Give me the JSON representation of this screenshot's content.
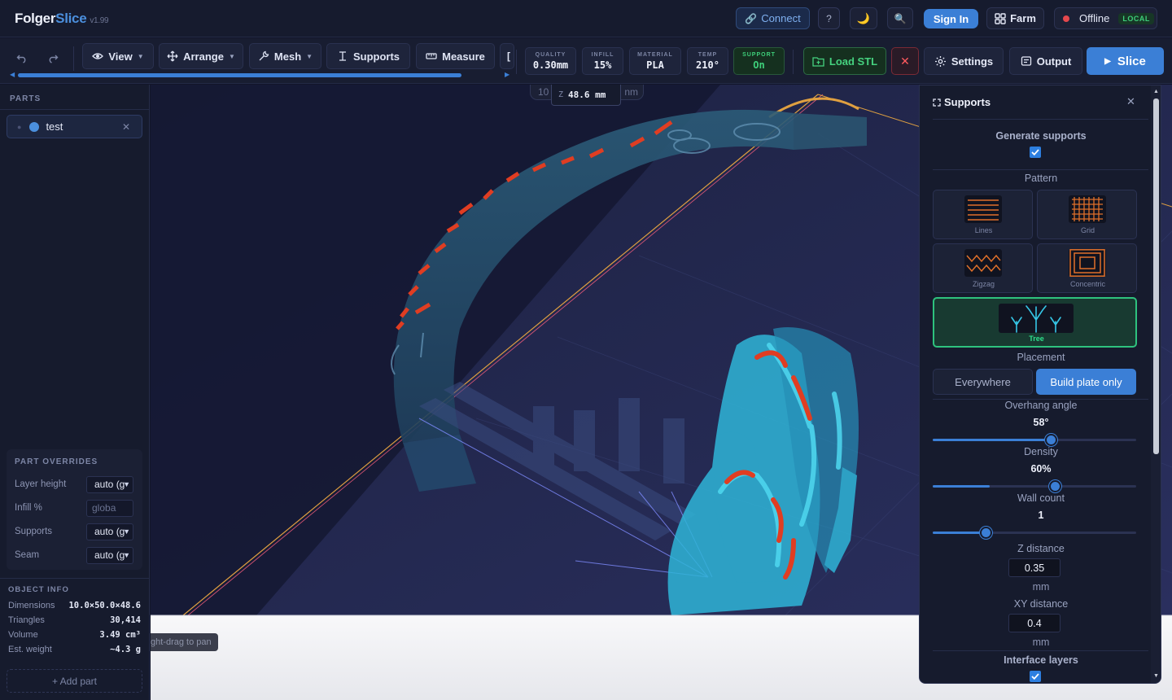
{
  "app": {
    "name_a": "Folger",
    "name_b": "Slice",
    "version": "v1.99"
  },
  "topbar": {
    "connect": "Connect",
    "help": "?",
    "signin": "Sign In",
    "farm": "Farm",
    "offline": "Offline",
    "local": "LOCAL"
  },
  "toolbar": {
    "view": "View",
    "arrange": "Arrange",
    "mesh": "Mesh",
    "supports": "Supports",
    "measure": "Measure",
    "stats": [
      {
        "label": "QUALITY",
        "value": "0.30mm"
      },
      {
        "label": "INFILL",
        "value": "15%"
      },
      {
        "label": "MATERIAL",
        "value": "PLA"
      },
      {
        "label": "TEMP",
        "value": "210°"
      },
      {
        "label": "SUPPORT",
        "value": "On"
      }
    ],
    "load_stl": "Load STL",
    "settings": "Settings",
    "output": "Output",
    "slice": "Slice",
    "scroll_position": 0.89
  },
  "parts": {
    "heading": "PARTS",
    "items": [
      {
        "name": "test",
        "color": "#4b8fdd"
      }
    ],
    "add_part": "+ Add part"
  },
  "overrides": {
    "heading": "PART OVERRIDES",
    "rows": [
      {
        "label": "Layer height",
        "value": "auto (g"
      },
      {
        "label": "Infill %",
        "placeholder": "globa"
      },
      {
        "label": "Supports",
        "value": "auto (g"
      },
      {
        "label": "Seam",
        "value": "auto (g"
      }
    ]
  },
  "object_info": {
    "heading": "OBJECT INFO",
    "rows": [
      {
        "label": "Dimensions",
        "value": "10.0×50.0×48.6"
      },
      {
        "label": "Triangles",
        "value": "30,414"
      },
      {
        "label": "Volume",
        "value": "3.49 cm³"
      },
      {
        "label": "Est. weight",
        "value": "~4.3 g"
      }
    ]
  },
  "viewport": {
    "coord_axis": "Z",
    "coord_value": "48.6 mm",
    "dims_left": "10",
    "dims_right": "nm",
    "hint": "ght-drag to pan"
  },
  "supports_panel": {
    "title": "Supports",
    "generate_label": "Generate supports",
    "generate_checked": true,
    "pattern_label": "Pattern",
    "patterns": [
      "Lines",
      "Grid",
      "Zigzag",
      "Concentric",
      "Tree"
    ],
    "selected_pattern": "Tree",
    "placement_label": "Placement",
    "placement_options": [
      "Everywhere",
      "Build plate only"
    ],
    "selected_placement": "Build plate only",
    "overhang_label": "Overhang angle",
    "overhang_value": "58°",
    "overhang_fraction": 0.58,
    "density_label": "Density",
    "density_value": "60%",
    "density_fraction": 0.6,
    "wall_label": "Wall count",
    "wall_value": "1",
    "wall_fraction": 0.26,
    "z_label": "Z distance",
    "z_value": "0.35",
    "z_unit": "mm",
    "xy_label": "XY distance",
    "xy_value": "0.4",
    "xy_unit": "mm",
    "interface_label": "Interface layers",
    "interface_checked": true
  },
  "colors": {
    "accent": "#3b7fd6",
    "success": "#2ec27e",
    "danger": "#e5484d",
    "pattern_orange": "#e0702a",
    "tree_cyan": "#35c6e6",
    "support_red": "#e04020"
  }
}
